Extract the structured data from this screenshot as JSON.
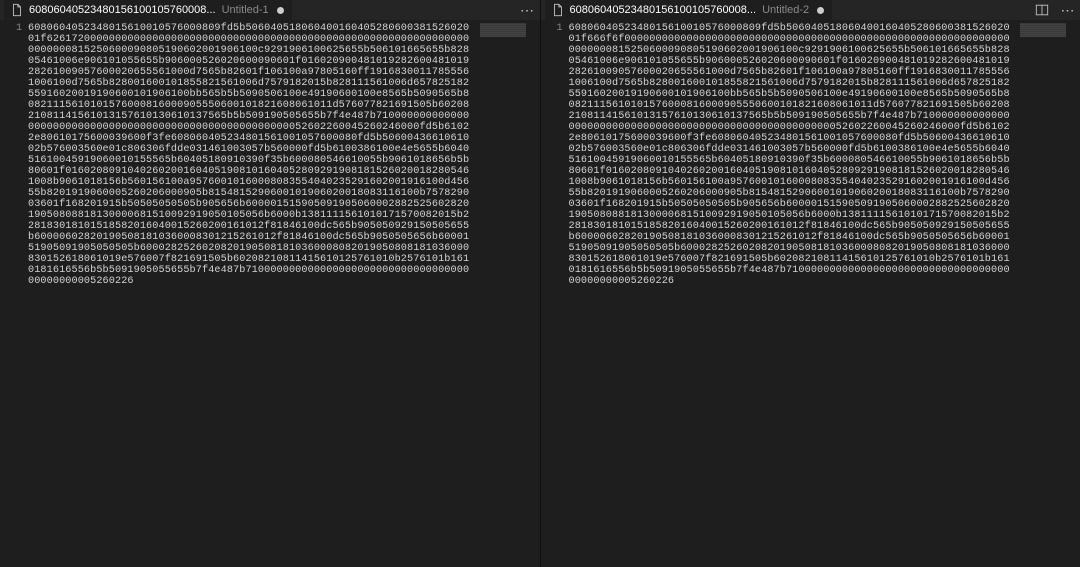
{
  "left_pane": {
    "tab": {
      "icon_name": "file-icon",
      "title": "60806040523480156100105760008...",
      "description": "Untitled-1",
      "modified": true
    },
    "actions": {
      "overflow": "⋯"
    },
    "gutter": {
      "line_number": "1"
    },
    "content": "6080604052348015610010576000809fd5b50604051806040016040528060038152602001f626172000000000000000000000000000000000000000000000000000000000000000000000815250600090805190602001906100c9291906100625655b506101665655b82805461006e906101055655b906000526020600090601f01602090048101928260048101928261009057600020655561000d7565b82601f106100a97805160ff19168300117855561006100d7565b828001600101855821561006d7579182015b828111561006d65782518255916020019190600101906100bb565b5b5090506100e49190600100e8565b5090565b80821115610101576000816000905550600101821608061011d576077821691505b6020821081141561013157610130610137565b5b509190505655b7f4e487b710000000000000000000000000000000000000000000000000000000052602260045260246000fd5b61022e80610175600039600f3fe608060405234801561001057600080fd5b5060043661061002b576003560e01c806306fdde031461003057b560000fd5b6100386100e4e5655b604051610045919060010155565b60405180910390f35b600080546610055b9061018656b5b80601f016020809104026020016040519081016040528092919081815260200182805461008b9061018156b560156100a95760010160008083554040235291602001916100d45655b8201919060005260206000905b8154815290600101906020018083116100b757829003601f168201915b50505050505b905656b60000151590509190506000288252560282019050808818130000681510092919050105056b6000b1381111561010171570082015b228183018101518582016040015260200161012f81846100dc565b905050929150505655b600006028201905081810360008301215261012f81846100dc565b9050505656b6000151905091905050505b60002825260208201905081810360008082019050808181036000830152618061019e576007f821691505b60208210811415610125761010b2576101b1610181616556b5b5091905055655b7f4e487b71000000000000000000000000000000000000000000005260226"
  },
  "right_pane": {
    "tab": {
      "icon_name": "file-icon",
      "title": "60806040523480156100105760008...",
      "description": "Untitled-2",
      "modified": true
    },
    "actions": {
      "split_layout_name": "split-editor-icon",
      "overflow": "⋯"
    },
    "gutter": {
      "line_number": "1"
    },
    "content": "6080604052348015610010576000809fd5b50604051806040016040528060038152602001f666f6f000000000000000000000000000000000000000000000000000000000000000000000815250600090805190602001906100c9291906100625655b506101665655b82805461006e906101055655b906000526020600090601f01602090048101928260048101928261009057600020655561000d7565b82601f106100a97805160ff19168300117855561006100d7565b828001600101855821561006d7579182015b828111561006d65782518255916020019190600101906100bb565b5b5090506100e49190600100e8565b5090565b80821115610101576000816000905550600101821608061011d576077821691505b6020821081141561013157610130610137565b5b509190505655b7f4e487b710000000000000000000000000000000000000000000000000000000052602260045260246000fd5b61022e80610175600039600f3fe608060405234801561001057600080fd5b5060043661061002b576003560e01c806306fdde031461003057b560000fd5b6100386100e4e5655b604051610045919060010155565b60405180910390f35b600080546610055b9061018656b5b80601f016020809104026020016040519081016040528092919081815260200182805461008b9061018156b560156100a95760010160008083554040235291602001916100d45655b8201919060005260206000905b8154815290600101906020018083116100b757829003601f168201915b50505050505b905656b60000151590509190506000288252560282019050808818130000681510092919050105056b6000b1381111561010171570082015b228183018101518582016040015260200161012f81846100dc565b905050929150505655b600006028201905081810360008301215261012f81846100dc565b9050505656b6000151905091905050505b60002825260208201905081810360008082019050808181036000830152618061019e576007f821691505b60208210811415610125761010b2576101b1610181616556b5b5091905055655b7f4e487b71000000000000000000000000000000000000000000005260226"
  }
}
